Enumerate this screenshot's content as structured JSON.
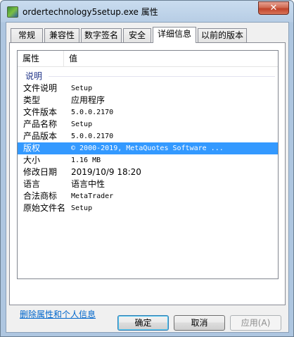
{
  "window": {
    "title": "ordertechnology5setup.exe 属性",
    "close_label": "✕"
  },
  "tabs": [
    {
      "label": "常规"
    },
    {
      "label": "兼容性"
    },
    {
      "label": "数字签名"
    },
    {
      "label": "安全"
    },
    {
      "label": "详细信息"
    },
    {
      "label": "以前的版本"
    }
  ],
  "listview": {
    "col_property": "属性",
    "col_value": "值",
    "group": "说明",
    "rows": [
      {
        "key": "文件说明",
        "value": "Setup"
      },
      {
        "key": "类型",
        "value": "应用程序"
      },
      {
        "key": "文件版本",
        "value": "5.0.0.2170"
      },
      {
        "key": "产品名称",
        "value": "Setup"
      },
      {
        "key": "产品版本",
        "value": "5.0.0.2170"
      },
      {
        "key": "版权",
        "value": "© 2000-2019, MetaQuotes Software ..."
      },
      {
        "key": "大小",
        "value": "1.16 MB"
      },
      {
        "key": "修改日期",
        "value": "2019/10/9 18:20"
      },
      {
        "key": "语言",
        "value": "语言中性"
      },
      {
        "key": "合法商标",
        "value": "MetaTrader"
      },
      {
        "key": "原始文件名",
        "value": "Setup"
      }
    ]
  },
  "remove_link": "删除属性和个人信息",
  "buttons": {
    "ok": "确定",
    "cancel": "取消",
    "apply": "应用(A)"
  },
  "colors": {
    "selection": "#3399ff",
    "link": "#0066cc",
    "group_title": "#1e3287"
  },
  "icons": {
    "app": "installer-icon",
    "close": "close-icon"
  }
}
